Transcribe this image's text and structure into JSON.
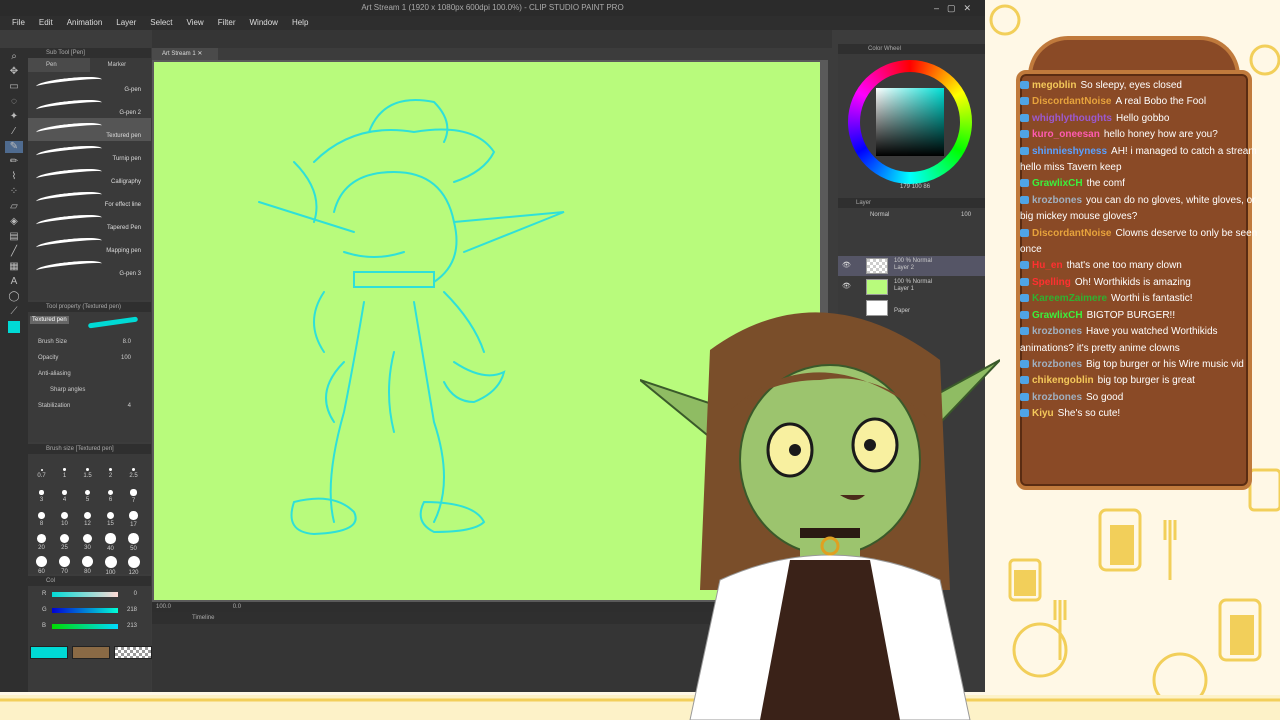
{
  "app": {
    "title": "Art Stream 1 (1920 x 1080px 600dpi 100.0%) - CLIP STUDIO PAINT PRO",
    "menu": [
      "File",
      "Edit",
      "Animation",
      "Layer",
      "Select",
      "View",
      "Filter",
      "Window",
      "Help"
    ],
    "doc_tab": "Art Stream 1",
    "status_zoom": "100.0",
    "status_angle": "0.0"
  },
  "subtool": {
    "panel_title": "Sub Tool [Pen]",
    "tabs": [
      "Pen",
      "Marker"
    ],
    "brushes": [
      "G-pen",
      "G-pen 2",
      "Textured pen",
      "Turnip pen",
      "Calligraphy",
      "For effect line",
      "Tapered Pen",
      "Mapping pen",
      "G-pen 3"
    ],
    "selected": "Textured pen"
  },
  "tool_property": {
    "panel_title": "Tool property (Textured pen)",
    "preview_label": "Textured pen",
    "brush_size_label": "Brush Size",
    "brush_size_value": "8.0",
    "opacity_label": "Opacity",
    "opacity_value": "100",
    "antialias_label": "Anti-aliasing",
    "sharp_label": "Sharp angles",
    "stabilization_label": "Stabilization",
    "stabilization_value": "4"
  },
  "brush_size": {
    "panel_title": "Brush size [Textured pen]",
    "sizes": [
      "0.7",
      "1",
      "1.5",
      "2",
      "2.5",
      "3",
      "4",
      "5",
      "6",
      "7",
      "8",
      "10",
      "12",
      "15",
      "17",
      "20",
      "25",
      "30",
      "40",
      "50",
      "60",
      "70",
      "80",
      "100",
      "120"
    ]
  },
  "color_sliders": {
    "panel_title": "Col",
    "r_label": "R",
    "r_value": "0",
    "g_label": "G",
    "g_value": "218",
    "b_label": "B",
    "b_value": "213",
    "main_color": "#00dad5",
    "sub_color": "#8a6a45"
  },
  "color_wheel": {
    "panel_title": "Color Wheel",
    "h": "179",
    "s": "100",
    "v": "86"
  },
  "layers": {
    "panel_title": "Layer",
    "blend": "Normal",
    "opacity": "100",
    "items": [
      {
        "opacity": "100 % Normal",
        "name": "Layer 2"
      },
      {
        "opacity": "100 % Normal",
        "name": "Layer 1"
      },
      {
        "opacity": "",
        "name": "Paper"
      }
    ]
  },
  "timeline": {
    "panel_title": "Timeline"
  },
  "chat": [
    {
      "user": "megoblin",
      "user_color": "#f4c85a",
      "text": "So sleepy, eyes closed"
    },
    {
      "user": "DiscordantNoise",
      "user_color": "#e6a23c",
      "text": "A real Bobo the Fool"
    },
    {
      "user": "whighlythoughts",
      "user_color": "#9b59d0",
      "text": "Hello gobbo"
    },
    {
      "user": "kuro_oneesan",
      "user_color": "#ff5bb0",
      "text": "hello honey how are you?"
    },
    {
      "user": "shinnieshyness",
      "user_color": "#5aa0ff",
      "text": "AH! i managed to catch a stream hello miss Tavern keep"
    },
    {
      "user": "GrawlixCH",
      "user_color": "#3cf03c",
      "text": "the comf"
    },
    {
      "user": "krozbones",
      "user_color": "#a0b0c0",
      "text": "you can do no gloves, white gloves, or big mickey mouse gloves?"
    },
    {
      "user": "DiscordantNoise",
      "user_color": "#e6a23c",
      "text": "Clowns deserve to only be seen once"
    },
    {
      "user": "Hu_en",
      "user_color": "#ff3030",
      "text": "that's one too many clown"
    },
    {
      "user": "Spelling",
      "user_color": "#ff3030",
      "text": "Oh! Worthikids is amazing"
    },
    {
      "user": "KareemZaimere",
      "user_color": "#30b030",
      "text": "Worthi is fantastic!"
    },
    {
      "user": "GrawlixCH",
      "user_color": "#3cf03c",
      "text": "BIGTOP BURGER!!"
    },
    {
      "user": "krozbones",
      "user_color": "#a0b0c0",
      "text": "Have you watched Worthikids animations? it's pretty anime clowns"
    },
    {
      "user": "krozbones",
      "user_color": "#a0b0c0",
      "text": "Big top burger or his Wire music vid"
    },
    {
      "user": "chikengoblin",
      "user_color": "#f4c85a",
      "text": "big top burger is great"
    },
    {
      "user": "krozbones",
      "user_color": "#a0b0c0",
      "text": "So good"
    },
    {
      "user": "Kiyu",
      "user_color": "#f4c85a",
      "text": "She's so cute!"
    }
  ]
}
